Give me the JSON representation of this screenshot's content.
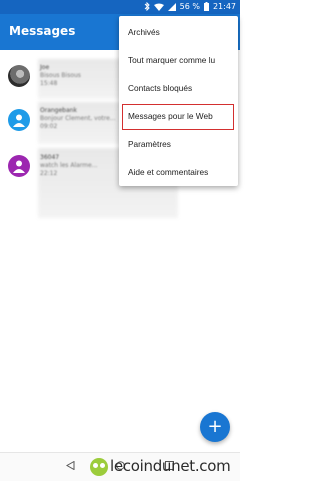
{
  "status_bar": {
    "battery_percent": "56 %",
    "time": "21:47"
  },
  "toolbar": {
    "title": "Messages"
  },
  "conversations": [
    {
      "name": "Joe",
      "preview": "Bisous Bisous",
      "meta": "15:48"
    },
    {
      "name": "Orangebank",
      "preview": "Bonjour Clement, votre...",
      "meta": "09:02"
    },
    {
      "name": "36047",
      "preview": "watch les Alarme...",
      "meta": "22:12"
    }
  ],
  "menu": {
    "items": [
      {
        "label": "Archivés"
      },
      {
        "label": "Tout marquer comme lu"
      },
      {
        "label": "Contacts bloqués"
      },
      {
        "label": "Messages pour le Web"
      },
      {
        "label": "Paramètres"
      },
      {
        "label": "Aide et commentaires"
      }
    ],
    "highlighted_index": 3,
    "highlight_color": "#d32f2f"
  },
  "fab": {
    "icon": "plus-icon"
  },
  "watermark": {
    "text": "lecoindunet.com"
  },
  "colors": {
    "toolbar": "#1976d2",
    "status_bar": "#1565c0",
    "fab": "#1976d2"
  }
}
